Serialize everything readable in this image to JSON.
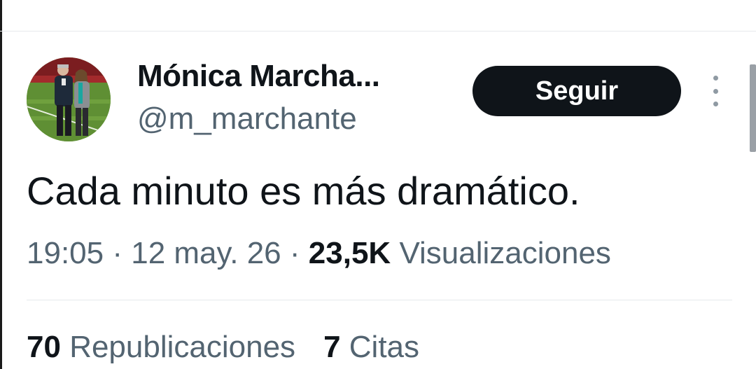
{
  "tweet": {
    "author_name": "Mónica Marcha...",
    "author_handle": "@m_marchante",
    "follow_label": "Seguir",
    "more_icon": "more-vertical-icon",
    "text": "Cada minuto es más dramático.",
    "time": "19:05",
    "separator": "·",
    "date": "12 may. 26",
    "views_count": "23,5K",
    "views_label": "Visualizaciones"
  },
  "stats": {
    "reposts_count": "70",
    "reposts_label": "Republicaciones",
    "quotes_count": "7",
    "quotes_label": "Citas"
  },
  "colors": {
    "text_primary": "#0f1419",
    "text_secondary": "#536471",
    "button_bg": "#0f1419",
    "button_text": "#ffffff",
    "divider": "#e6e9ec"
  }
}
